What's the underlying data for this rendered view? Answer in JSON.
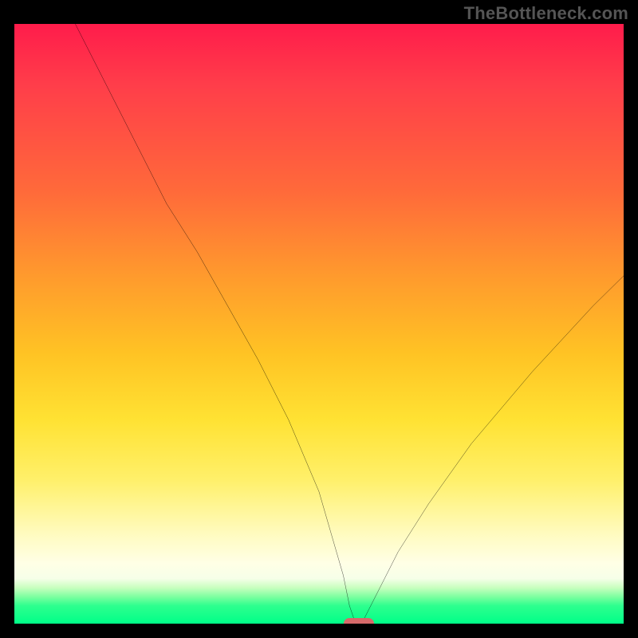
{
  "watermark": "TheBottleneck.com",
  "chart_data": {
    "type": "line",
    "title": "",
    "xlabel": "",
    "ylabel": "",
    "xlim": [
      0,
      100
    ],
    "ylim": [
      0,
      100
    ],
    "grid": false,
    "legend": false,
    "series": [
      {
        "name": "bottleneck-curve",
        "x": [
          10,
          15,
          20,
          25,
          30,
          35,
          40,
          45,
          50,
          52,
          54,
          55,
          56,
          57,
          58,
          60,
          63,
          68,
          75,
          85,
          95,
          100
        ],
        "y": [
          100,
          90,
          80,
          70,
          62,
          53,
          44,
          34,
          22,
          15,
          8,
          3,
          0,
          0,
          2,
          6,
          12,
          20,
          30,
          42,
          53,
          58
        ]
      }
    ],
    "marker": {
      "x_start": 54,
      "x_end": 59,
      "y": 0,
      "color": "#d66a6a"
    },
    "background_gradient": {
      "stops": [
        {
          "pct": 0,
          "color": "#ff1c4b"
        },
        {
          "pct": 28,
          "color": "#ff6a3a"
        },
        {
          "pct": 55,
          "color": "#ffc324"
        },
        {
          "pct": 76,
          "color": "#fff06a"
        },
        {
          "pct": 92,
          "color": "#f6ffe8"
        },
        {
          "pct": 100,
          "color": "#00ff88"
        }
      ]
    }
  }
}
